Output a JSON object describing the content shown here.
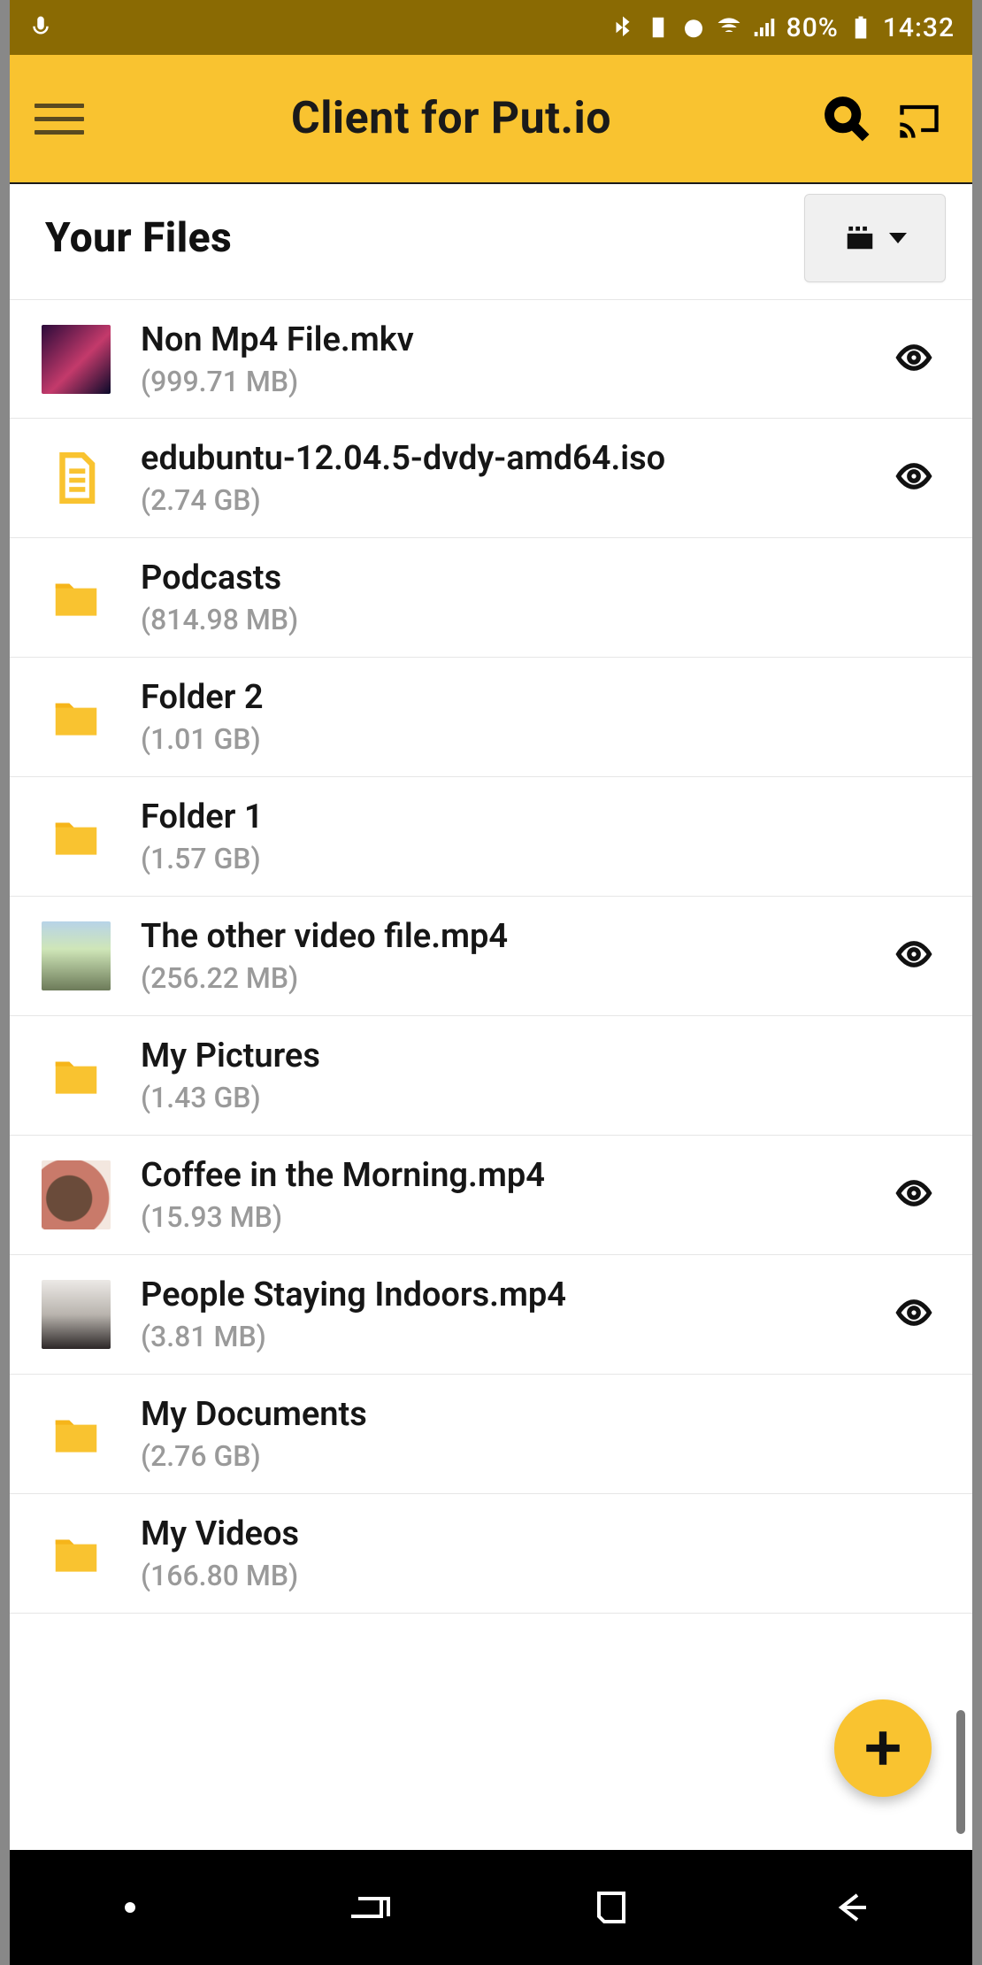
{
  "statusbar": {
    "battery_pct": "80%",
    "time": "14:32"
  },
  "appbar": {
    "title": "Client for Put.io"
  },
  "section": {
    "title": "Your Files"
  },
  "files": [
    {
      "name": "Non Mp4 File.mkv",
      "size": "(999.71 MB)",
      "thumb": "video1",
      "eye": true
    },
    {
      "name": "edubuntu-12.04.5-dvdy-amd64.iso",
      "size": "(2.74 GB)",
      "thumb": "doc",
      "eye": true
    },
    {
      "name": "Podcasts",
      "size": "(814.98 MB)",
      "thumb": "folder",
      "eye": false
    },
    {
      "name": "Folder 2",
      "size": "(1.01 GB)",
      "thumb": "folder",
      "eye": false
    },
    {
      "name": "Folder 1",
      "size": "(1.57 GB)",
      "thumb": "folder",
      "eye": false
    },
    {
      "name": "The other video file.mp4",
      "size": "(256.22 MB)",
      "thumb": "video2",
      "eye": true
    },
    {
      "name": "My Pictures",
      "size": "(1.43 GB)",
      "thumb": "folder",
      "eye": false
    },
    {
      "name": "Coffee in the Morning.mp4",
      "size": "(15.93 MB)",
      "thumb": "video3",
      "eye": true
    },
    {
      "name": "People Staying Indoors.mp4",
      "size": "(3.81 MB)",
      "thumb": "video4",
      "eye": true
    },
    {
      "name": "My Documents",
      "size": "(2.76 GB)",
      "thumb": "folder",
      "eye": false
    },
    {
      "name": "My Videos",
      "size": "(166.80 MB)",
      "thumb": "folder",
      "eye": false
    }
  ],
  "colors": {
    "accent": "#f9c330",
    "statusbar_bg": "#8a6a03"
  }
}
